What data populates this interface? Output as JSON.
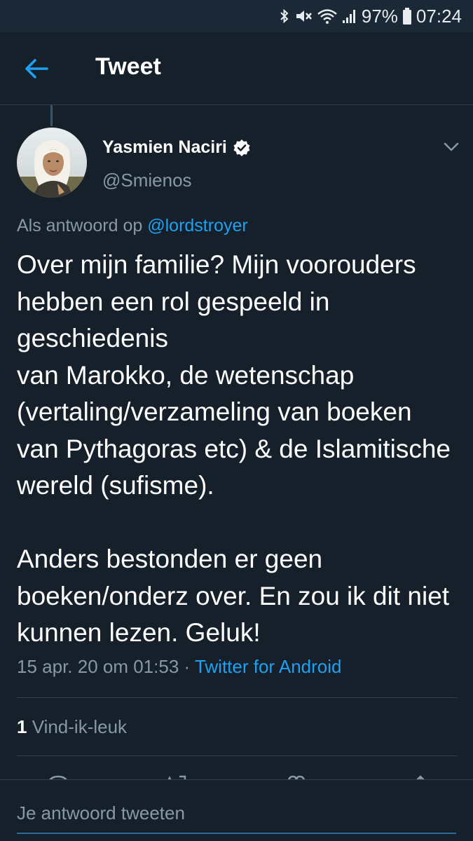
{
  "status_bar": {
    "battery": "97%",
    "time": "07:24",
    "icons": [
      "bluetooth-icon",
      "mute-icon",
      "wifi-icon",
      "signal-icon",
      "battery-icon"
    ]
  },
  "header": {
    "back_icon": "arrow-left-icon",
    "title": "Tweet"
  },
  "tweet": {
    "author": {
      "name": "Yasmien Naciri",
      "handle": "@Smienos",
      "verified": true
    },
    "reply_prefix": "Als antwoord op",
    "reply_mention": "@lordstroyer",
    "text": "Over mijn familie? Mijn voorouders hebben een rol gespeeld in geschiedenis\nvan Marokko, de wetenschap (vertaling/verzameling van boeken van Pythagoras etc) & de Islamitische wereld (sufisme).\n\nAnders bestonden er geen boeken/onderz over. En zou ik dit niet kunnen lezen. Geluk!",
    "timestamp": "15 apr. 20 om 01:53",
    "separator": " · ",
    "source": "Twitter for Android",
    "like_count": "1",
    "like_label": "Vind-ik-leuk"
  },
  "reply_box": {
    "placeholder": "Je antwoord tweeten"
  },
  "colors": {
    "background": "#15202b",
    "accent": "#1da1f2",
    "secondary_text": "#8899a6",
    "divider": "#2f3d4c"
  }
}
